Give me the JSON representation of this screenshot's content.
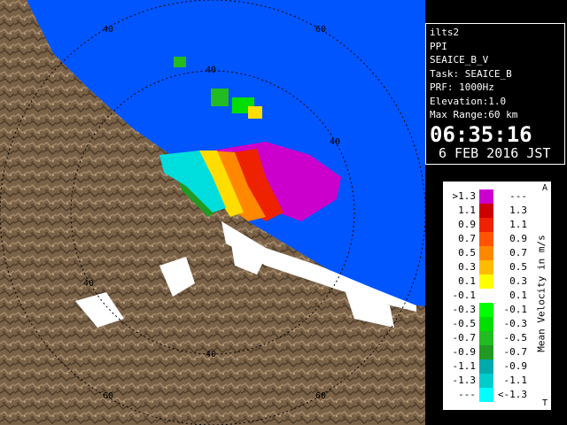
{
  "info": {
    "site": "ilts2",
    "mode": "PPI",
    "product": "SEAICE_B_V",
    "task": "Task: SEAICE_B",
    "prf": "PRF: 1000Hz",
    "elevation": "Elevation:1.0",
    "max_range": "Max Range:60 km",
    "time": "06:35:16",
    "date": "6 FEB 2016 JST"
  },
  "range_labels": [
    "40",
    "60",
    "40",
    "40",
    "40",
    "60",
    "40",
    "60"
  ],
  "legend": {
    "title": "Mean Velocity in m/s",
    "top_mark": "A",
    "bottom_mark": "T",
    "rows": [
      {
        "lo": ">1.3",
        "hi": "---",
        "color": "#cc00cc"
      },
      {
        "lo": "1.1",
        "hi": "1.3",
        "color": "#cc0000"
      },
      {
        "lo": "0.9",
        "hi": "1.1",
        "color": "#ee2200"
      },
      {
        "lo": "0.7",
        "hi": "0.9",
        "color": "#ff5500"
      },
      {
        "lo": "0.5",
        "hi": "0.7",
        "color": "#ff8800"
      },
      {
        "lo": "0.3",
        "hi": "0.5",
        "color": "#ffbb00"
      },
      {
        "lo": "0.1",
        "hi": "0.3",
        "color": "#ffff00"
      },
      {
        "lo": "-0.1",
        "hi": "0.1",
        "color": "#ffffff"
      },
      {
        "lo": "-0.3",
        "hi": "-0.1",
        "color": "#00ff00"
      },
      {
        "lo": "-0.5",
        "hi": "-0.3",
        "color": "#00dd00"
      },
      {
        "lo": "-0.7",
        "hi": "-0.5",
        "color": "#22bb22"
      },
      {
        "lo": "-0.9",
        "hi": "-0.7",
        "color": "#229922"
      },
      {
        "lo": "-1.1",
        "hi": "-0.9",
        "color": "#00aaaa"
      },
      {
        "lo": "-1.3",
        "hi": "-1.1",
        "color": "#00cccc"
      },
      {
        "lo": "---",
        "hi": "<-1.3",
        "color": "#00ffff"
      }
    ]
  },
  "colors": {
    "sea": "#0055ff",
    "land": "#7a6248",
    "range_ring": "#000000"
  }
}
